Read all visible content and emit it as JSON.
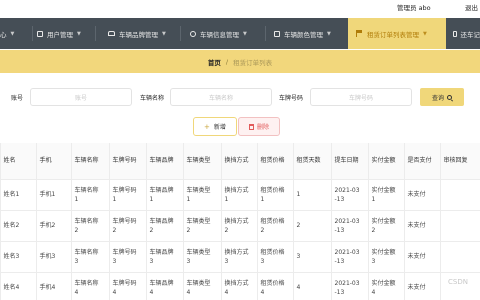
{
  "header": {
    "admin_label": "管理员 abo",
    "logout_label": "退出"
  },
  "nav": {
    "items": [
      {
        "label": "心",
        "icon": "chevron-down-icon"
      },
      {
        "label": "用户管理",
        "icon": "user-icon"
      },
      {
        "label": "车辆品牌管理",
        "icon": "car-icon"
      },
      {
        "label": "车辆信息管理",
        "icon": "info-icon"
      },
      {
        "label": "车辆颜色管理",
        "icon": "grid-icon"
      },
      {
        "label": "租赁订单列表管理",
        "icon": "flag-icon",
        "active": true
      },
      {
        "label": "还车记",
        "icon": "document-icon"
      }
    ],
    "active_bg": "#f0d77a",
    "bar_bg": "#454e56"
  },
  "breadcrumb": {
    "home": "首页",
    "separator": "/",
    "current": "租赁订单列表"
  },
  "search": {
    "fields": [
      {
        "label": "账号",
        "placeholder": "账号"
      },
      {
        "label": "车辆名称",
        "placeholder": "车辆名称"
      },
      {
        "label": "车牌号码",
        "placeholder": "车牌号码"
      }
    ],
    "button_label": "查询"
  },
  "actions": {
    "add_label": "新增",
    "delete_label": "删除"
  },
  "table": {
    "headers": [
      "",
      "姓名",
      "手机",
      "车辆名称",
      "车牌号码",
      "车辆品牌",
      "车辆类型",
      "换挡方式",
      "租赁价格",
      "租赁天数",
      "提车日期",
      "实付金额",
      "是否支付",
      "审核回复"
    ],
    "rows": [
      [
        "",
        "姓名1",
        "手机1",
        "车辆名称\n1",
        "车牌号码\n1",
        "车辆品牌\n1",
        "车辆类型\n1",
        "换挡方式\n1",
        "租赁价格\n1",
        "1",
        "2021-03\n-13",
        "实付金额\n1",
        "未支付",
        ""
      ],
      [
        "",
        "姓名2",
        "手机2",
        "车辆名称\n2",
        "车牌号码\n2",
        "车辆品牌\n2",
        "车辆类型\n2",
        "换挡方式\n2",
        "租赁价格\n2",
        "2",
        "2021-03\n-13",
        "实付金额\n2",
        "未支付",
        ""
      ],
      [
        "",
        "姓名3",
        "手机3",
        "车辆名称\n3",
        "车牌号码\n3",
        "车辆品牌\n3",
        "车辆类型\n3",
        "换挡方式\n3",
        "租赁价格\n3",
        "3",
        "2021-03\n-13",
        "实付金额\n3",
        "未支付",
        ""
      ],
      [
        "",
        "姓名4",
        "手机4",
        "车辆名称\n4",
        "车牌号码\n4",
        "车辆品牌\n4",
        "车辆类型\n4",
        "换挡方式\n4",
        "租赁价格\n4",
        "4",
        "2021-03\n-13",
        "实付金额\n4",
        "未支付",
        ""
      ]
    ]
  },
  "watermark": "CSDN"
}
